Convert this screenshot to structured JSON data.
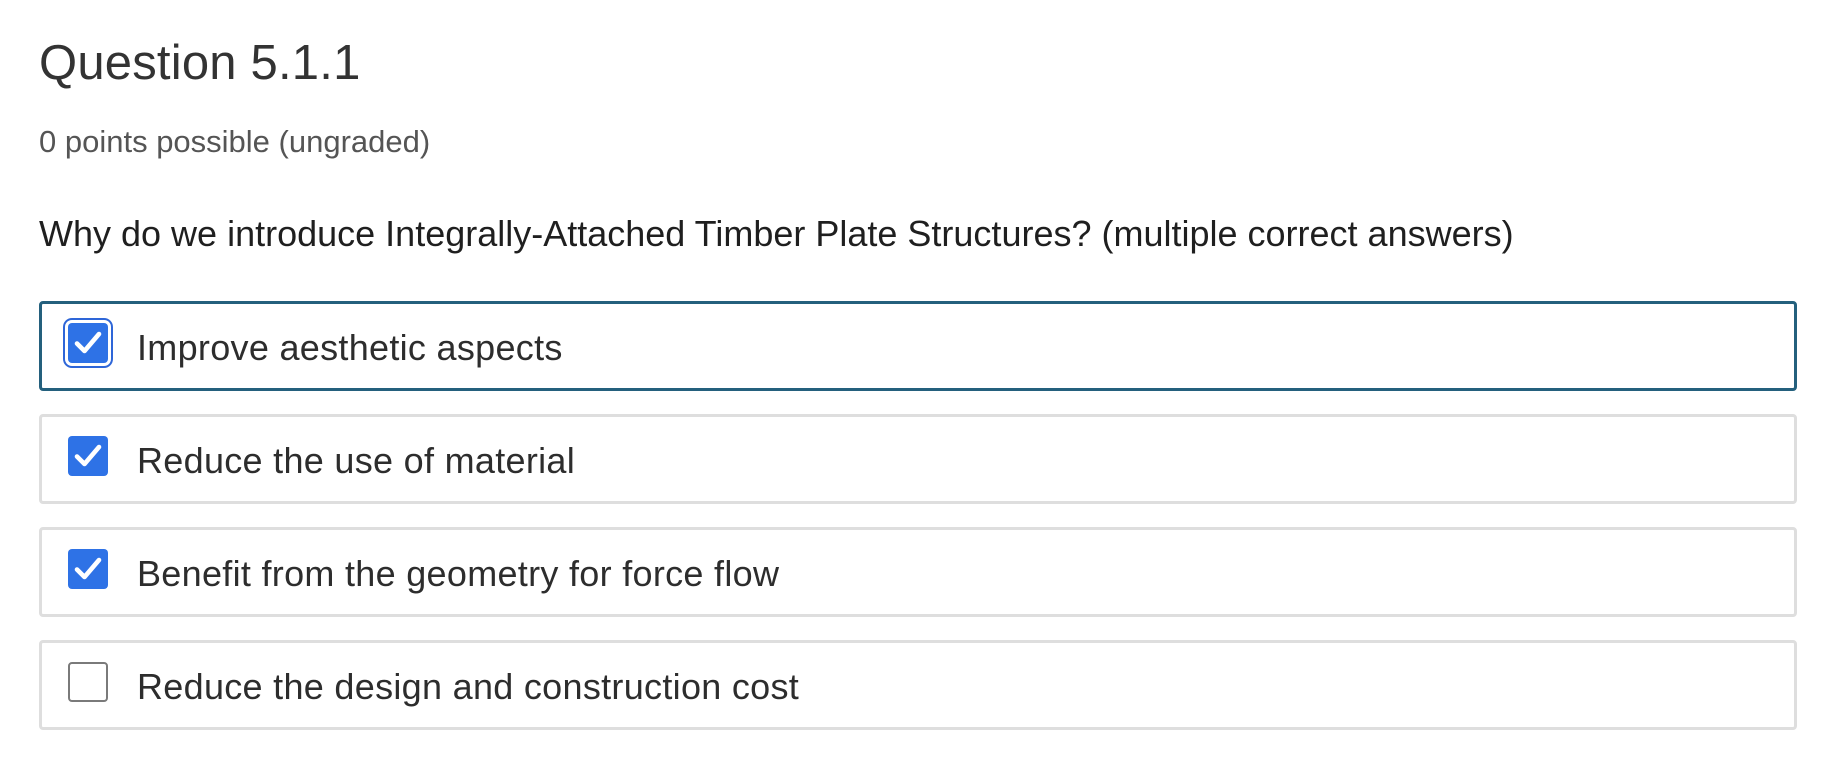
{
  "question": {
    "title": "Question 5.1.1",
    "points": "0 points possible (ungraded)",
    "prompt": "Why do we introduce Integrally-Attached Timber Plate Structures? (multiple correct answers)"
  },
  "choices": [
    {
      "label": "Improve aesthetic aspects",
      "checked": true,
      "focused": true
    },
    {
      "label": "Reduce the use of material",
      "checked": true,
      "focused": false
    },
    {
      "label": "Benefit from the geometry for force flow",
      "checked": true,
      "focused": false
    },
    {
      "label": "Reduce the design and construction cost",
      "checked": false,
      "focused": false
    }
  ],
  "colors": {
    "accent": "#2e72e6",
    "focus_border": "#24607d",
    "choice_border": "#dedede"
  },
  "icons": {
    "checkmark": "checkmark-icon"
  }
}
